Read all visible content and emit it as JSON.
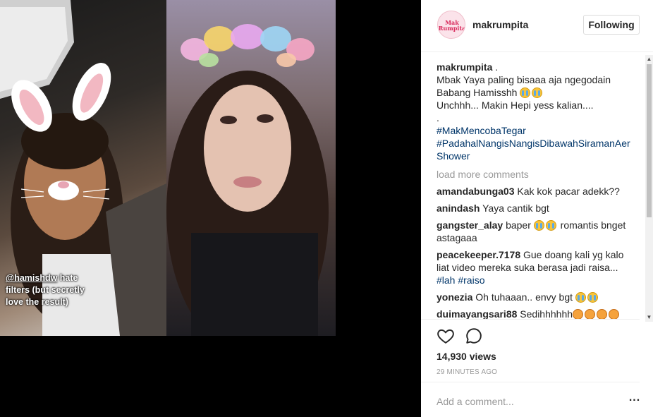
{
  "post": {
    "username": "makrumpita",
    "avatar_text": "Mak Rumpita",
    "follow_label": "Following"
  },
  "media": {
    "overlay_handle": "@hamishdw",
    "overlay_text": " hate filters (but secretly love the result)"
  },
  "caption": {
    "username": "makrumpita",
    "suffix": " .",
    "lines": [
      "Mbak Yaya paling bisaaa aja ngegodain",
      "Babang Hamisshh",
      "Unchhh... Makin Hepi yess kalian....",
      "."
    ],
    "hashtags": [
      "#MakMencobaTegar",
      "#PadahalNangisNangisDibawahSiramanAer",
      "Shower"
    ]
  },
  "load_more": "load more comments",
  "comments": [
    {
      "user": "amandabunga03",
      "text": "Kak kok pacar adekk??"
    },
    {
      "user": "anindash",
      "text": "Yaya cantik bgt"
    },
    {
      "user": "gangster_alay",
      "text": "baper",
      "text2": "romantis bnget astagaaa"
    },
    {
      "user": "peacekeeper.7178",
      "text": "Gue doang kali yg kalo liat video mereka suka berasa jadi raisa...",
      "tags": [
        "#lah",
        "#raiso"
      ]
    },
    {
      "user": "yonezia",
      "text": "Oh tuhaaan.. envy bgt"
    },
    {
      "user": "duimayangsari88",
      "text": "Sedihhhhhh"
    }
  ],
  "stats": {
    "views": "14,930 views",
    "time_ago": "29 MINUTES AGO"
  },
  "add_comment": {
    "placeholder": "Add a comment...",
    "more_label": "..."
  },
  "icons": {
    "like": "heart-icon",
    "comment": "comment-bubble-icon",
    "scroll_up": "chevron-up-icon",
    "scroll_down": "chevron-down-icon"
  },
  "colors": {
    "hashtag": "#003569",
    "muted": "#999999",
    "border": "#efefef"
  }
}
